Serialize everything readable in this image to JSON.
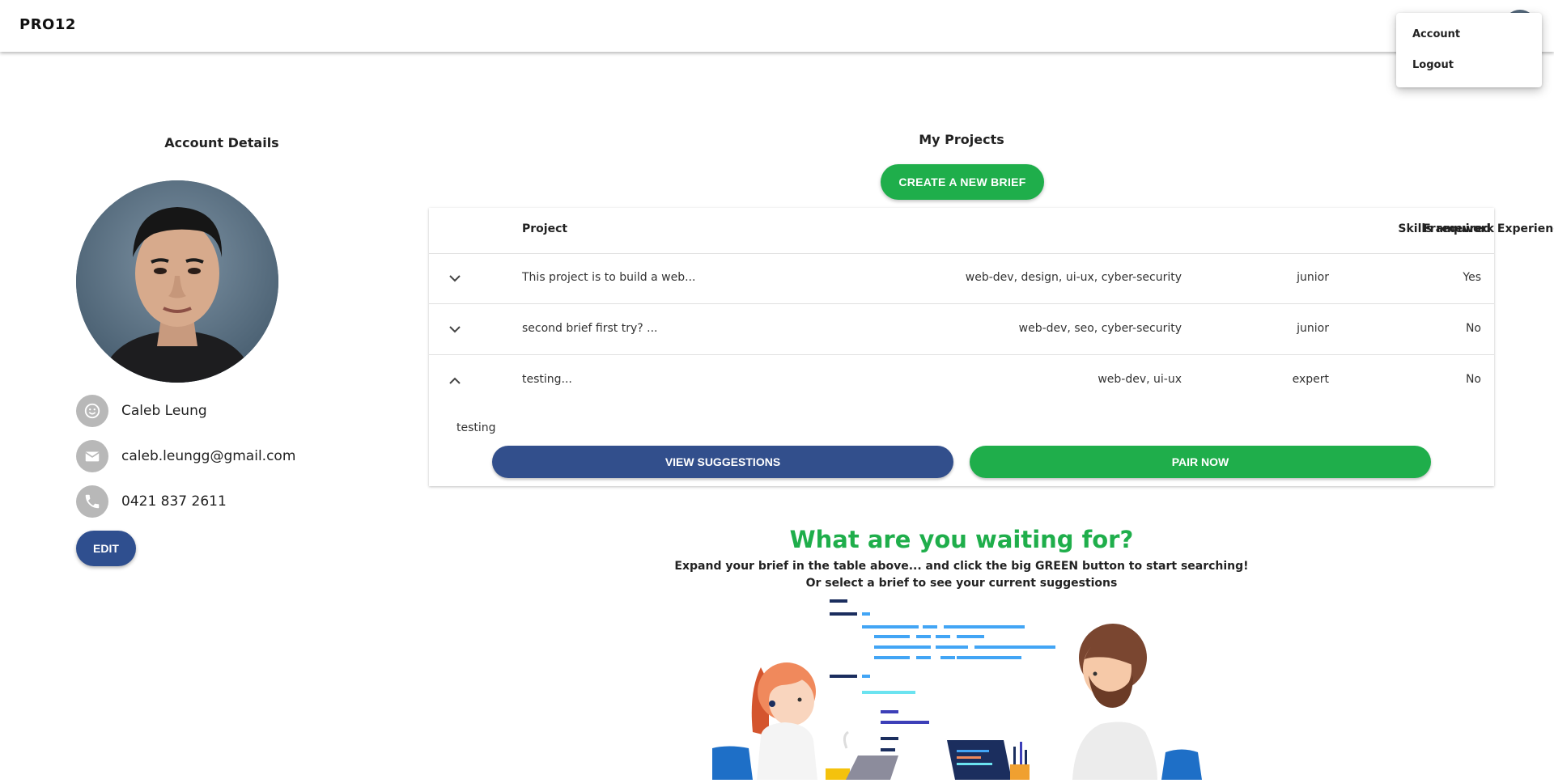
{
  "header": {
    "brand": "PRO12"
  },
  "user_menu": {
    "items": [
      {
        "label": "Account"
      },
      {
        "label": "Logout"
      }
    ]
  },
  "account": {
    "title": "Account Details",
    "name": "Caleb Leung",
    "email": "caleb.leungg@gmail.com",
    "phone": "0421 837 2611",
    "edit_label": "EDIT"
  },
  "projects": {
    "title": "My Projects",
    "create_label": "CREATE A NEW BRIEF",
    "columns": [
      "Project",
      "Skills required",
      "Experience",
      "Framework"
    ],
    "rows": [
      {
        "project": "This project is to build a web...",
        "skills": "web-dev, design, ui-ux, cyber-security",
        "experience": "junior",
        "framework": "Yes",
        "expanded": false
      },
      {
        "project": "second brief first try? ...",
        "skills": "web-dev, seo, cyber-security",
        "experience": "junior",
        "framework": "No",
        "expanded": false
      },
      {
        "project": "testing...",
        "skills": "web-dev, ui-ux",
        "experience": "expert",
        "framework": "No",
        "expanded": true
      }
    ],
    "expanded_detail": {
      "description": "testing",
      "view_label": "VIEW SUGGESTIONS",
      "pair_label": "PAIR NOW"
    }
  },
  "cta": {
    "title": "What are you waiting for?",
    "line1": "Expand your brief in the table above... and click the big GREEN button to start searching!",
    "line2": "Or select a brief to see your current suggestions"
  },
  "colors": {
    "primary_blue": "#2f4f8f",
    "primary_green": "#1fae4b"
  }
}
